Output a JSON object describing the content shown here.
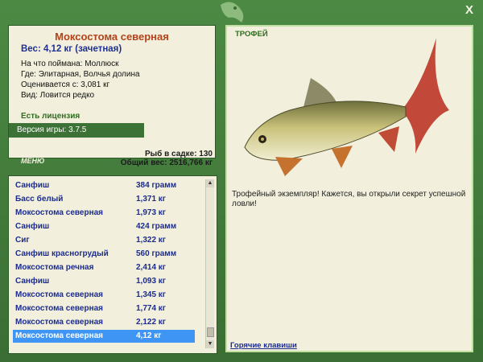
{
  "fish": {
    "name": "Моксостома северная",
    "weight": "Вес: 4,12 кг (зачетная)",
    "bait": "На что поймана: Моллюск",
    "location": "Где: Элитарная, Волчья долина",
    "valued": "Оценивается с: 3,081 кг",
    "kind": "Вид: Ловится редко"
  },
  "license": "Есть лицензия",
  "version": "Версия игры: 3.7.5",
  "menu_label": "МЕНЮ",
  "stats": {
    "in_cage": "Рыб в садке: 130",
    "total_weight": "Общий вес: 2516,766 кг"
  },
  "trophy": {
    "label": "ТРОФЕЙ",
    "text": "Трофейный экземпляр! Кажется, вы открыли секрет успешной ловли!",
    "hotkeys": "Горячие клавиши"
  },
  "catches": [
    {
      "name": "Санфиш",
      "weight": "384 грамм"
    },
    {
      "name": "Басс белый",
      "weight": "1,371 кг"
    },
    {
      "name": "Моксостома северная",
      "weight": "1,973 кг"
    },
    {
      "name": "Санфиш",
      "weight": "424 грамм"
    },
    {
      "name": "Сиг",
      "weight": "1,322 кг"
    },
    {
      "name": "Санфиш красногрудый",
      "weight": "560 грамм"
    },
    {
      "name": "Моксостома речная",
      "weight": "2,414 кг"
    },
    {
      "name": "Санфиш",
      "weight": "1,093 кг"
    },
    {
      "name": "Моксостома северная",
      "weight": "1,345 кг"
    },
    {
      "name": "Моксостома северная",
      "weight": "1,774 кг"
    },
    {
      "name": "Моксостома северная",
      "weight": "2,122 кг"
    },
    {
      "name": "Моксостома северная",
      "weight": "4,12 кг",
      "selected": true
    }
  ],
  "close_label": "X"
}
